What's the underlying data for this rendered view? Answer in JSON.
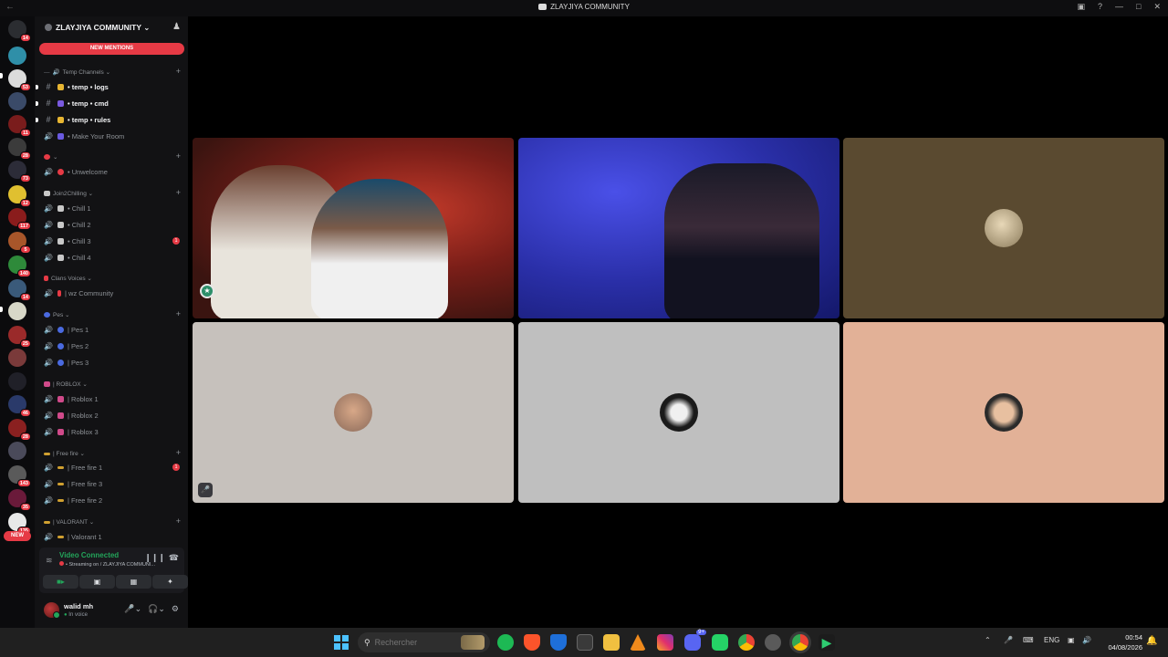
{
  "window": {
    "title": "ZLAYJIYA COMMUNITY"
  },
  "rail": {
    "badges": [
      "14",
      "53",
      "11",
      "28",
      "73",
      "12",
      "117",
      "5",
      "140",
      "14",
      "25",
      "46",
      "28",
      "143",
      "35",
      "135"
    ],
    "new_label": "NEW"
  },
  "server": {
    "name": "ZLAYJIYA COMMUNITY ⌄",
    "mentions_label": "NEW MENTIONS"
  },
  "categories": {
    "temp": "Temp Channels ⌄",
    "unwelcome": "⌄",
    "join2chilling": "Join2Chilling ⌄",
    "clans": "Clans Voices ⌄",
    "pes": "Pes ⌄",
    "roblox": "| ROBLOX ⌄",
    "freefire": "| Free fire ⌄",
    "valorant": "| VALORANT ⌄"
  },
  "channels": {
    "temp_logs": "• temp • logs",
    "temp_cmd": "• temp • cmd",
    "temp_rules": "• temp • rules",
    "make_room": "• Make Your Room",
    "unwelcome": "• Unwelcome",
    "chill1": "• Chill 1",
    "chill2": "• Chill 2",
    "chill3": "• Chill 3",
    "chill4": "• Chill 4",
    "wz": "| wz Community",
    "pes1": "| Pes 1",
    "pes2": "| Pes 2",
    "pes3": "| Pes 3",
    "roblox1": "| Roblox 1",
    "roblox2": "| Roblox 2",
    "roblox3": "| Roblox 3",
    "ff1": "| Free fire 1",
    "ff3": "| Free fire 3",
    "ff2": "| Free fire 2",
    "valorant1": "| Valorant 1"
  },
  "channel_badges": {
    "chill3": "1",
    "ff1": "1"
  },
  "voice": {
    "status": "Video Connected",
    "subtitle": "• Streaming on / ZLAYJIYA COMMUNI..."
  },
  "user": {
    "name": "walid mh",
    "status": "In voice"
  },
  "taskbar": {
    "search_placeholder": "Rechercher",
    "lang": "ENG",
    "time": "00:54",
    "date": "04/08/2026",
    "notif_badge": "9+"
  },
  "colors": {
    "tile_1": "#7a2a22",
    "tile_2": "#3a3fbf",
    "tile_3": "#5a4a30",
    "tile_4": "#c6c1bc",
    "tile_5": "#bfbfbf",
    "tile_6": "#e2b197",
    "accent_red": "#e63a45",
    "voice_green": "#23a55a"
  },
  "icons": [
    "back-icon",
    "discord-logo-icon",
    "inbox-icon",
    "help-icon",
    "minimize-icon",
    "maximize-icon",
    "close-icon",
    "add-member-icon",
    "hash-icon",
    "speaker-icon",
    "signal-icon",
    "soundboard-icon",
    "disconnect-icon",
    "camera-icon",
    "screen-share-icon",
    "activity-icon",
    "mic-icon",
    "headphones-icon",
    "settings-icon",
    "windows-start-icon",
    "search-icon",
    "mic-off-icon"
  ]
}
